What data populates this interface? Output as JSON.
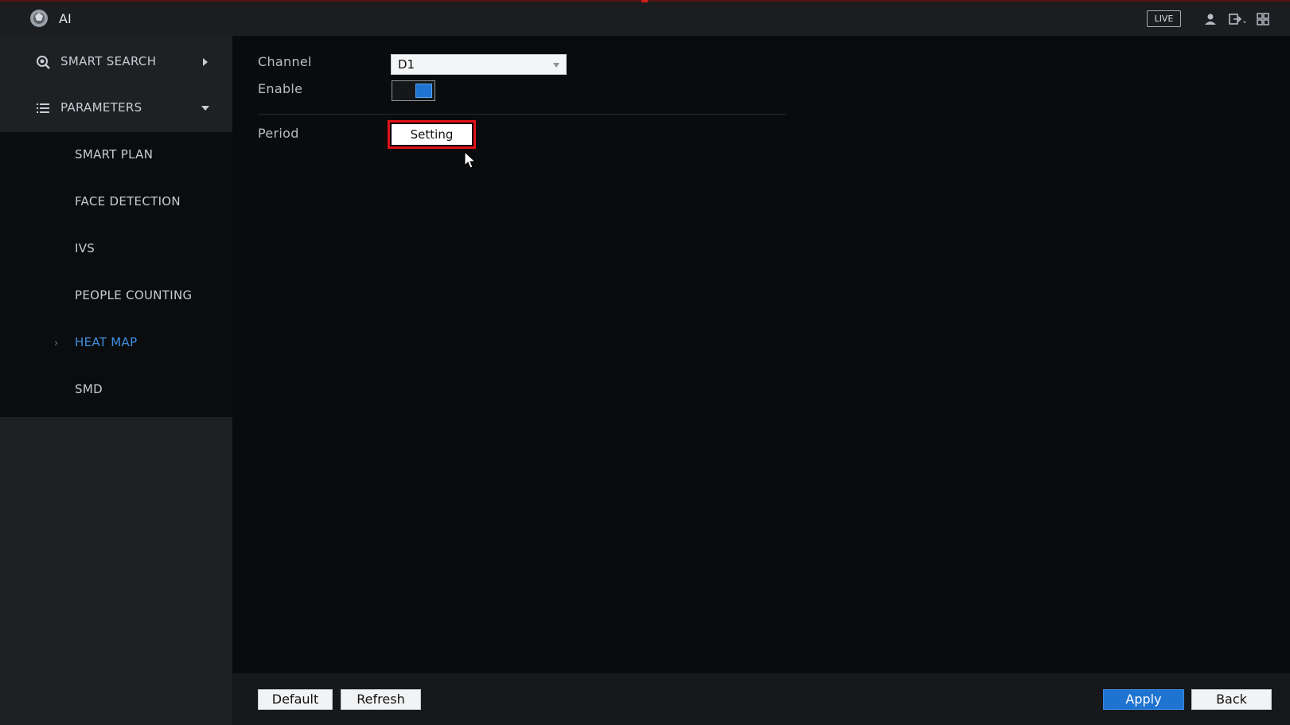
{
  "header": {
    "title": "AI",
    "live_label": "LIVE",
    "icons": [
      "ai-logo-icon",
      "user-icon",
      "logout-icon",
      "grid-menu-icon"
    ]
  },
  "sidebar": {
    "groups": [
      {
        "label": "SMART SEARCH",
        "icon": "smart-search-icon",
        "caret": "right"
      },
      {
        "label": "PARAMETERS",
        "icon": "list-icon",
        "caret": "down"
      }
    ],
    "items": [
      {
        "label": "SMART PLAN"
      },
      {
        "label": "FACE DETECTION"
      },
      {
        "label": "IVS"
      },
      {
        "label": "PEOPLE COUNTING"
      },
      {
        "label": "HEAT MAP",
        "active": true
      },
      {
        "label": "SMD"
      }
    ]
  },
  "form": {
    "channel_label": "Channel",
    "channel_value": "D1",
    "enable_label": "Enable",
    "enable_on": true,
    "period_label": "Period",
    "setting_button": "Setting"
  },
  "footer": {
    "default_label": "Default",
    "refresh_label": "Refresh",
    "apply_label": "Apply",
    "back_label": "Back"
  },
  "colors": {
    "accent": "#1f74d1",
    "active_nav": "#3f8fe0",
    "highlight": "#e0121a"
  }
}
